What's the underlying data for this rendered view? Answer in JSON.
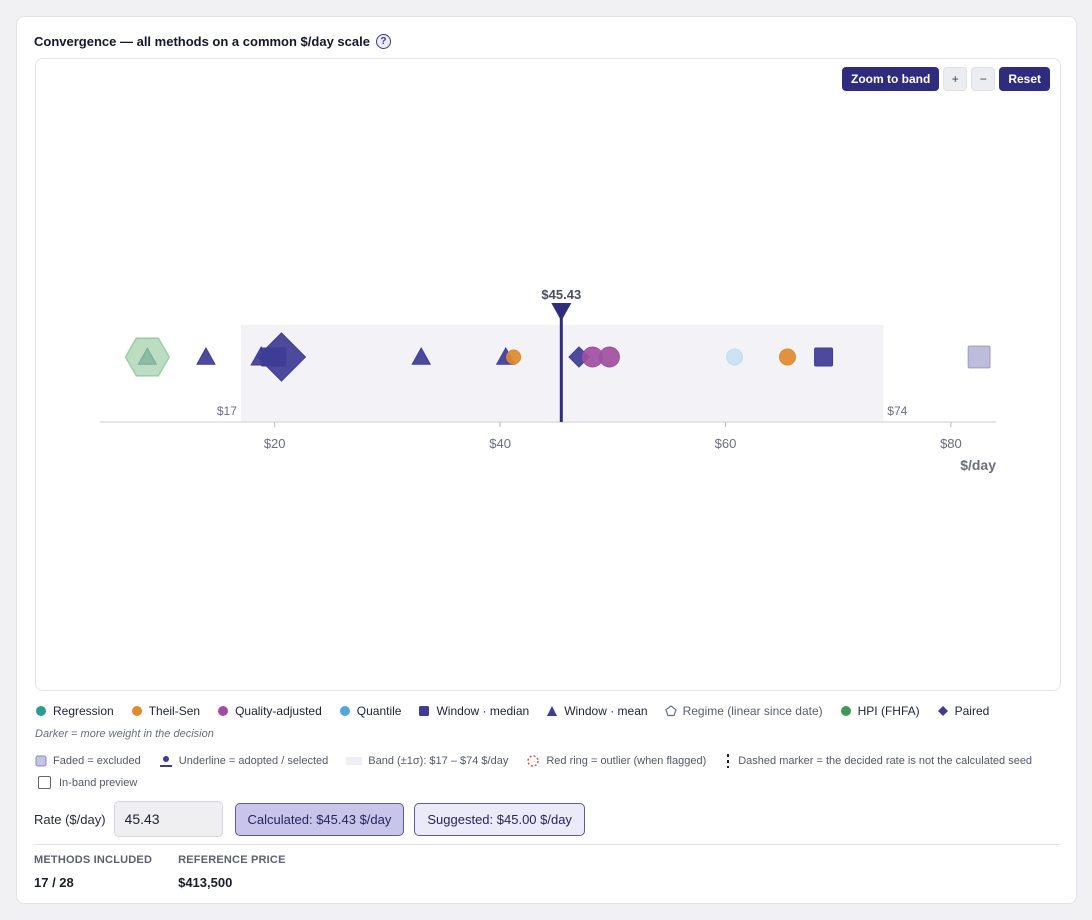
{
  "panel": {
    "title": "Convergence — all methods on a common $/day scale",
    "help_glyph": "?"
  },
  "zoom": {
    "zoom_band_label": "Zoom to band",
    "plus_label": "+",
    "minus_label": "−",
    "reset_label": "Reset"
  },
  "chart_data": {
    "type": "scatter",
    "xlabel": "$/day",
    "xlim": [
      4.5,
      84
    ],
    "xticks": [
      20,
      40,
      60,
      80
    ],
    "tick_prefix": "$",
    "band": {
      "low": 17,
      "high": 74,
      "low_label": "$17",
      "high_label": "$74"
    },
    "decided_rate": {
      "value": 45.43,
      "label": "$45.43"
    },
    "points": [
      {
        "method": "HPI (FHFA)",
        "shape": "hexagon",
        "x": 8.7,
        "size": 22,
        "color": "#5aaa6a",
        "faded": true
      },
      {
        "method": "Window · mean",
        "shape": "triangle",
        "x": 8.7,
        "size": 9,
        "color": "#5e9a86",
        "faded": true
      },
      {
        "method": "Window · mean",
        "shape": "triangle",
        "x": 13.9,
        "size": 9,
        "color": "#3f3c96",
        "faded": false
      },
      {
        "method": "Window · mean",
        "shape": "triangle",
        "x": 18.8,
        "size": 10,
        "color": "#3f3c96",
        "faded": false
      },
      {
        "method": "Window · median",
        "shape": "square",
        "x": 19.6,
        "size": 9,
        "color": "#3f3c96",
        "faded": false
      },
      {
        "method": "Window · median",
        "shape": "square",
        "x": 20.2,
        "size": 9,
        "color": "#3f3c96",
        "faded": false
      },
      {
        "method": "Paired",
        "shape": "diamond",
        "x": 20.6,
        "size": 24,
        "color": "#3f3c96",
        "faded": false
      },
      {
        "method": "Window · mean",
        "shape": "triangle",
        "x": 33.0,
        "size": 9,
        "color": "#3f3c96",
        "faded": false
      },
      {
        "method": "Window · mean",
        "shape": "triangle",
        "x": 40.5,
        "size": 9,
        "color": "#3f3c96",
        "faded": false
      },
      {
        "method": "Theil-Sen",
        "shape": "circle",
        "x": 41.2,
        "size": 7,
        "color": "#e08a2e",
        "faded": false
      },
      {
        "method": "Paired",
        "shape": "diamond",
        "x": 47.0,
        "size": 10,
        "color": "#3f3c96",
        "faded": false
      },
      {
        "method": "Quality-adjusted",
        "shape": "circle",
        "x": 48.2,
        "size": 10,
        "color": "#a04fa0",
        "faded": false
      },
      {
        "method": "Quality-adjusted",
        "shape": "circle",
        "x": 49.7,
        "size": 10,
        "color": "#a04fa0",
        "faded": false
      },
      {
        "method": "Quantile",
        "shape": "circle",
        "x": 60.8,
        "size": 8,
        "color": "#a8d4ec",
        "faded": true
      },
      {
        "method": "Theil-Sen",
        "shape": "circle",
        "x": 65.5,
        "size": 8,
        "color": "#e08a2e",
        "faded": false
      },
      {
        "method": "Window · median",
        "shape": "square",
        "x": 68.7,
        "size": 9,
        "color": "#3f3c96",
        "faded": false
      },
      {
        "method": "Window · median",
        "shape": "square",
        "x": 82.5,
        "size": 11,
        "color": "#7c7ab8",
        "faded": true
      }
    ]
  },
  "legend": [
    {
      "label": "Regression",
      "shape": "circle",
      "color": "#2a9d8f"
    },
    {
      "label": "Theil-Sen",
      "shape": "circle",
      "color": "#e08a2e"
    },
    {
      "label": "Quality-adjusted",
      "shape": "circle",
      "color": "#a04fa0"
    },
    {
      "label": "Quantile",
      "shape": "circle",
      "color": "#4fa8dc"
    },
    {
      "label": "Window · median",
      "shape": "square",
      "color": "#3f3c96"
    },
    {
      "label": "Window · mean",
      "shape": "triangle",
      "color": "#3f3c96"
    },
    {
      "label": "Regime (linear since date)",
      "shape": "pentagon",
      "color": "#6b6e80"
    },
    {
      "label": "HPI (FHFA)",
      "shape": "circle",
      "color": "#3f9a5a"
    },
    {
      "label": "Paired",
      "shape": "diamond",
      "color": "#3f3c96"
    }
  ],
  "weight_note": "Darker = more weight in the decision",
  "legend2": [
    {
      "label": "Faded = excluded",
      "key": "faded"
    },
    {
      "label": "Underline = adopted / selected",
      "key": "underline"
    },
    {
      "label": "Band (±1σ): $17 – $74 $/day",
      "key": "band"
    },
    {
      "label": "Red ring = outlier (when flagged)",
      "key": "redring"
    },
    {
      "label": "Dashed marker = the decided rate is not the calculated seed",
      "key": "dashed"
    }
  ],
  "preview_label": "In-band preview",
  "rate": {
    "label": "Rate ($/day)",
    "value": "45.43",
    "calculated": "Calculated: $45.43 $/day",
    "suggested": "Suggested: $45.00 $/day"
  },
  "stats": {
    "methods_label": "METHODS INCLUDED",
    "methods_value": "17 / 28",
    "price_label": "REFERENCE PRICE",
    "price_value": "$413,500"
  }
}
